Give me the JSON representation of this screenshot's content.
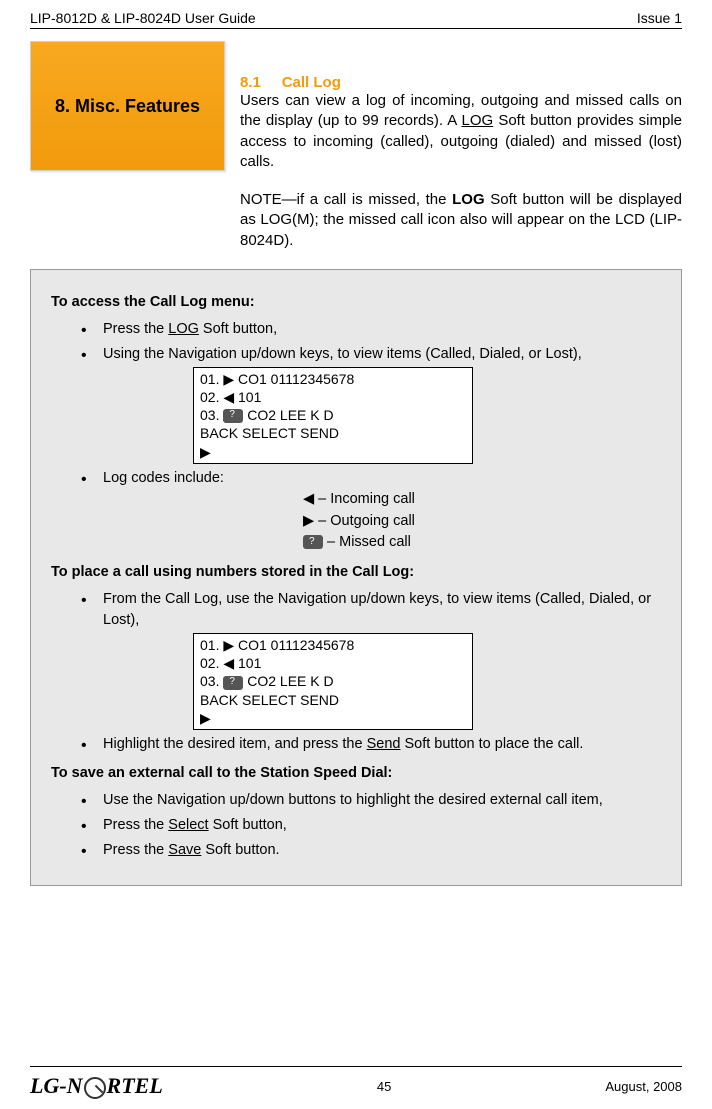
{
  "header": {
    "left": "LIP-8012D & LIP-8024D User Guide",
    "right": "Issue 1"
  },
  "feature_box": "8. Misc. Features",
  "section": {
    "number": "8.1",
    "title": "Call Log"
  },
  "intro": {
    "p1_a": "Users can view a log of incoming, outgoing and missed calls on the display (up to 99 records).  A ",
    "p1_log": "LOG",
    "p1_b": " Soft button provides simple access to incoming (called), outgoing (dialed) and missed (lost) calls.",
    "p2_a": "NOTE—if a call is missed, the ",
    "p2_bold": "LOG",
    "p2_b": " Soft button will be displayed as LOG(M); the missed call icon also will appear on the LCD (LIP-8024D)."
  },
  "box": {
    "h1": "To access the Call Log menu:",
    "b1_a": "Press the ",
    "b1_log": "LOG",
    "b1_b": " Soft button,",
    "b2": "Using the Navigation up/down keys, to view items (Called, Dialed, or Lost),",
    "lcd1": {
      "l1": "01. ▶  CO1  01112345678",
      "l2": "02. ◀  101",
      "l3_a": "03. ",
      "l3_b": " CO2  LEE K D",
      "l4": "      BACK     SELECT   SEND",
      "l5": "▶"
    },
    "b3": "Log codes include:",
    "codes": {
      "c1": "◀ – Incoming call",
      "c2": "▶ – Outgoing call",
      "c3": " – Missed call"
    },
    "h2": "To place a call using numbers stored in the Call Log:",
    "b4": "From the Call Log, use the Navigation up/down keys, to view items (Called, Dialed, or Lost),",
    "lcd2": {
      "l1": "01. ▶  CO1  01112345678",
      "l2": "02. ◀  101",
      "l3_a": "03. ",
      "l3_b": " CO2  LEE K D",
      "l4": "      BACK     SELECT   SEND",
      "l5": "▶"
    },
    "b5_a": "Highlight the desired item, and press the ",
    "b5_send": "Send",
    "b5_b": " Soft button to place the call.",
    "h3": "To save an external call to the Station Speed Dial:",
    "b6": "Use the Navigation up/down buttons to highlight the desired external call item,",
    "b7_a": "Press the ",
    "b7_select": "Select",
    "b7_b": " Soft button,",
    "b8_a": "Press the ",
    "b8_save": "Save",
    "b8_b": " Soft button."
  },
  "footer": {
    "logo_left": "LG-N",
    "logo_right": "RTEL",
    "page": "45",
    "date": "August, 2008"
  }
}
